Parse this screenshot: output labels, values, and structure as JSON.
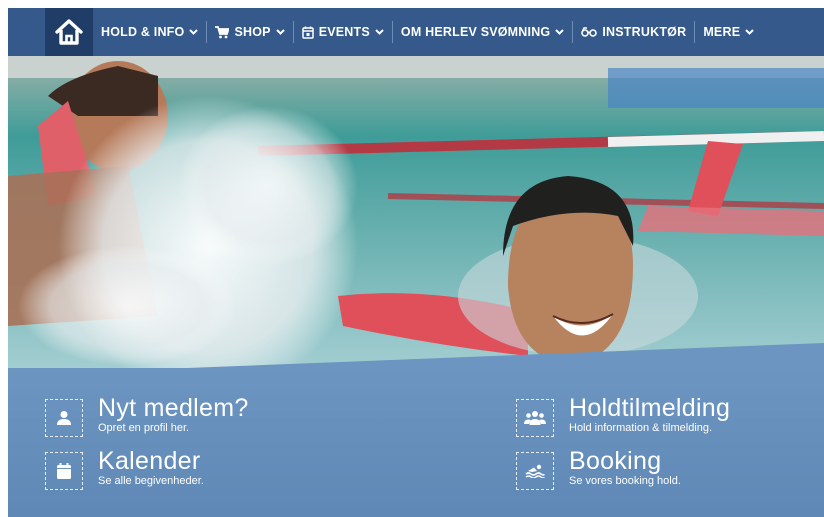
{
  "nav": {
    "items": [
      {
        "label": "HOLD & INFO",
        "icon": null,
        "dropdown": true
      },
      {
        "label": "SHOP",
        "icon": "cart-icon",
        "dropdown": true
      },
      {
        "label": "EVENTS",
        "icon": "calendar-icon",
        "dropdown": true
      },
      {
        "label": "OM HERLEV SVØMNING",
        "icon": null,
        "dropdown": true
      },
      {
        "label": "INSTRUKTØR",
        "icon": "glasses-icon",
        "dropdown": false
      },
      {
        "label": "MERE",
        "icon": null,
        "dropdown": true
      }
    ]
  },
  "links": [
    {
      "title": "Nyt medlem?",
      "subtitle": "Opret en profil her.",
      "icon": "user-icon"
    },
    {
      "title": "Holdtilmelding",
      "subtitle": "Hold information & tilmelding.",
      "icon": "group-icon"
    },
    {
      "title": "Kalender",
      "subtitle": "Se alle begivenheder.",
      "icon": "calendar-icon"
    },
    {
      "title": "Booking",
      "subtitle": "Se vores booking hold.",
      "icon": "swimmer-icon"
    }
  ],
  "colors": {
    "nav": "#34598a",
    "home": "#1f3d66",
    "banner": "#6d95c1",
    "pool": "#3f9c98",
    "lane_rope": "#b33a44"
  }
}
